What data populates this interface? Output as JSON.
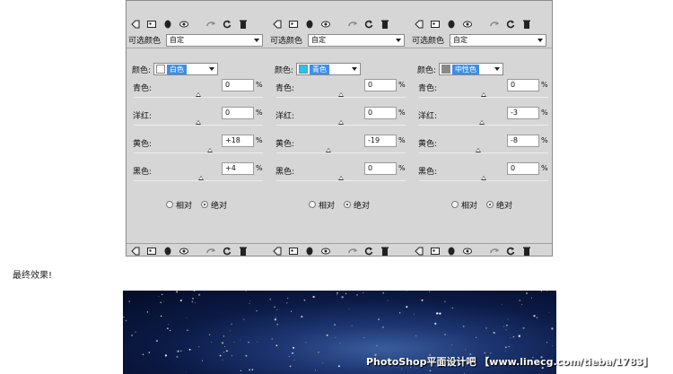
{
  "panel": {
    "toolbar_icons": [
      "clip-icon",
      "visibility-icon",
      "previous-state-icon",
      "reset-icon",
      "eye-icon",
      "delete-icon"
    ],
    "columns": [
      {
        "preset_label": "可选颜色",
        "preset_value": "自定",
        "color_label": "颜色:",
        "color_name": "白色",
        "color_swatch": "#ffffff",
        "color_fill": "#3d8ee8",
        "sliders": [
          {
            "label": "青色:",
            "value": "0",
            "unit": "%",
            "position": 0.5
          },
          {
            "label": "洋红:",
            "value": "0",
            "unit": "%",
            "position": 0.5
          },
          {
            "label": "黄色:",
            "value": "+18",
            "unit": "%",
            "position": 0.59
          },
          {
            "label": "黑色:",
            "value": "+4",
            "unit": "%",
            "position": 0.52
          }
        ],
        "method_relative": "相对",
        "method_absolute": "绝对",
        "method_selected": "absolute"
      },
      {
        "preset_label": "可选颜色",
        "preset_value": "自定",
        "color_label": "颜色:",
        "color_name": "青色",
        "color_swatch": "#27c4f2",
        "color_fill": "#3d8ee8",
        "sliders": [
          {
            "label": "青色:",
            "value": "0",
            "unit": "%",
            "position": 0.5
          },
          {
            "label": "洋红:",
            "value": "0",
            "unit": "%",
            "position": 0.5
          },
          {
            "label": "黄色:",
            "value": "-19",
            "unit": "%",
            "position": 0.405
          },
          {
            "label": "黑色:",
            "value": "0",
            "unit": "%",
            "position": 0.5
          }
        ],
        "method_relative": "相对",
        "method_absolute": "绝对",
        "method_selected": "absolute"
      },
      {
        "preset_label": "可选颜色",
        "preset_value": "自定",
        "color_label": "颜色:",
        "color_name": "中性色",
        "color_swatch": "#8a8a8a",
        "color_fill": "#3d8ee8",
        "sliders": [
          {
            "label": "青色:",
            "value": "0",
            "unit": "%",
            "position": 0.5
          },
          {
            "label": "洋红:",
            "value": "-3",
            "unit": "%",
            "position": 0.485
          },
          {
            "label": "黄色:",
            "value": "-8",
            "unit": "%",
            "position": 0.46
          },
          {
            "label": "黑色:",
            "value": "0",
            "unit": "%",
            "position": 0.5
          }
        ],
        "method_relative": "相对",
        "method_absolute": "绝对",
        "method_selected": "absolute"
      }
    ]
  },
  "caption": "最终效果!",
  "watermark": "PhotoShop平面设计吧 【www.linecg.com/tieba/1783】"
}
